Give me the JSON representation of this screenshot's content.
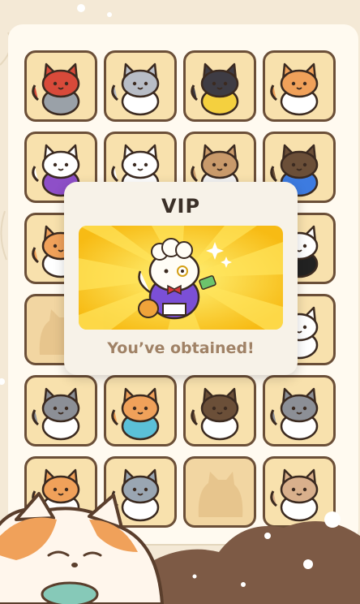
{
  "grid": {
    "rows": [
      [
        {
          "name": "cat-red-hood",
          "locked": false
        },
        {
          "name": "cat-gray-mask",
          "locked": false
        },
        {
          "name": "cat-batman",
          "locked": false
        },
        {
          "name": "cat-orange-tabby",
          "locked": false
        }
      ],
      [
        {
          "name": "cat-clown-king",
          "locked": false
        },
        {
          "name": "cat-white-fluffy",
          "locked": false
        },
        {
          "name": "cat-professor-glasses",
          "locked": false
        },
        {
          "name": "cat-superman",
          "locked": false
        }
      ],
      [
        {
          "name": "cat-orange-calico",
          "locked": false
        },
        {
          "name": "cat-hidden-1",
          "locked": false
        },
        {
          "name": "cat-hidden-2",
          "locked": false
        },
        {
          "name": "cat-panda",
          "locked": false
        }
      ],
      [
        {
          "name": "cat-locked-silhouette",
          "locked": true
        },
        {
          "name": "cat-hidden-3",
          "locked": false
        },
        {
          "name": "cat-hidden-4",
          "locked": false
        },
        {
          "name": "cat-white",
          "locked": false
        }
      ],
      [
        {
          "name": "cat-gray-fluffy",
          "locked": false
        },
        {
          "name": "cat-hawaiian-shirt",
          "locked": false
        },
        {
          "name": "cat-pirate",
          "locked": false
        },
        {
          "name": "cat-gray-white",
          "locked": false
        }
      ],
      [
        {
          "name": "cat-orange-small",
          "locked": false
        },
        {
          "name": "cat-gray-stripe",
          "locked": false
        },
        {
          "name": "cat-locked-silhouette-2",
          "locked": true
        },
        {
          "name": "cat-cream-shy",
          "locked": false
        }
      ]
    ]
  },
  "dialog": {
    "title": "VIP",
    "message": "You’ve obtained!",
    "reward_icon": "vip-rich-cat-icon"
  },
  "colors": {
    "card_bg": "#f8e1ad",
    "card_border": "#6b4f38",
    "panel_bg": "#fffaf0",
    "dialog_bg": "#f7f2e8",
    "reward_bg": "#f7c21c",
    "message_color": "#a08266"
  }
}
